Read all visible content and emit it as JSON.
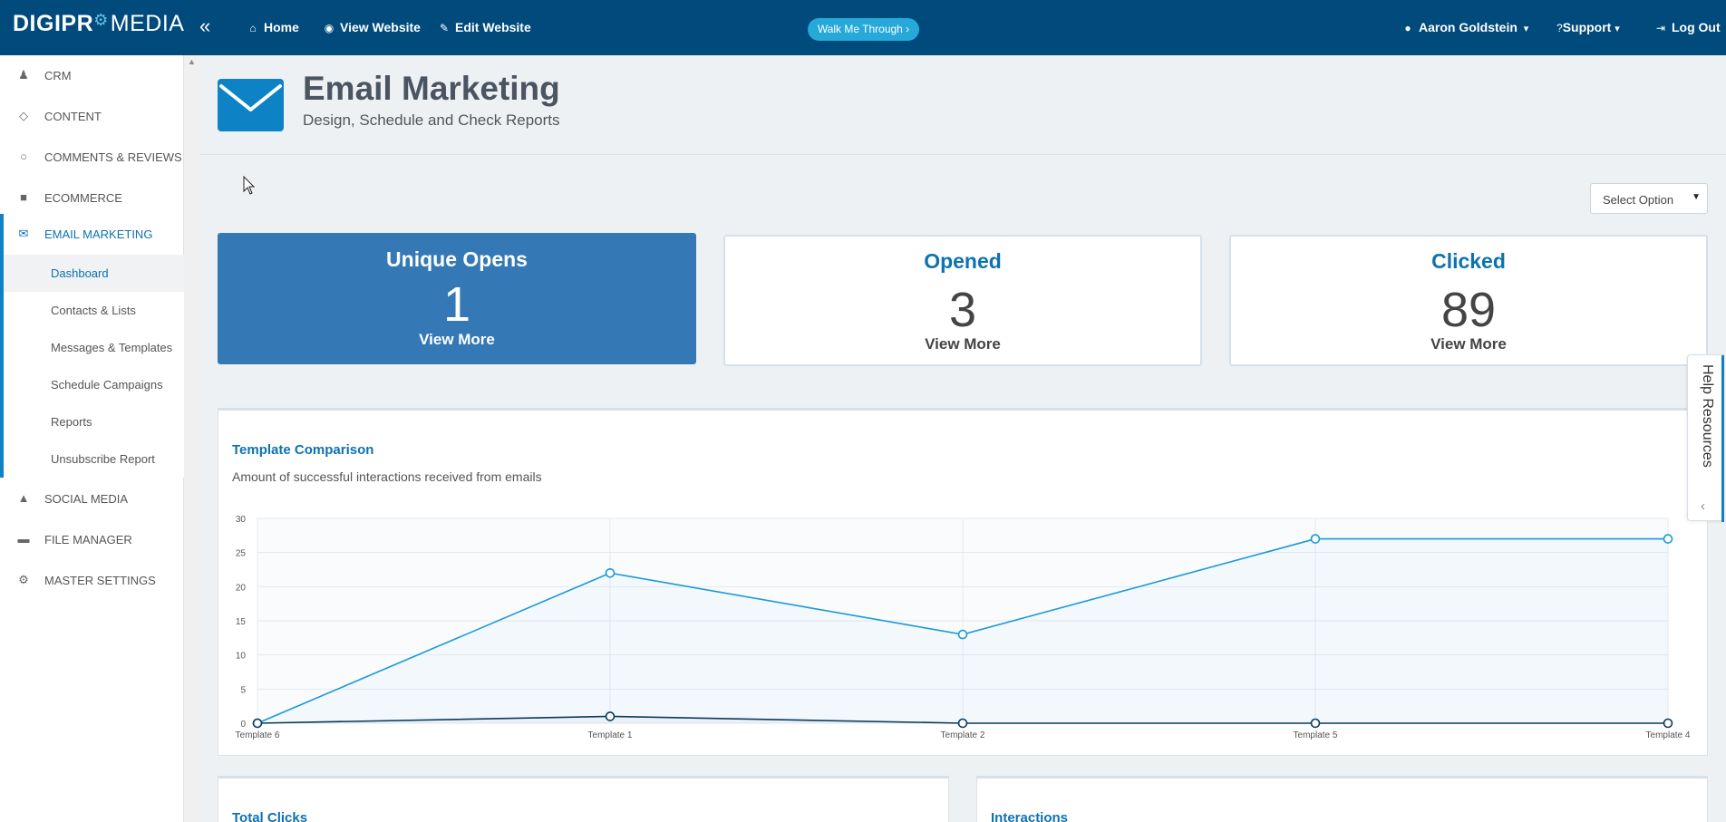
{
  "topbar": {
    "logo_part1": "DIGIPR",
    "logo_part2": "MEDIA",
    "links": [
      {
        "label": "Home"
      },
      {
        "label": "View Website"
      },
      {
        "label": "Edit Website"
      }
    ],
    "walk_label": "Walk Me Through ›",
    "user_label": "Aaron Goldstein",
    "support_label": "Support",
    "logout_label": "Log Out"
  },
  "sidebar": {
    "items": [
      {
        "label": "CRM"
      },
      {
        "label": "CONTENT"
      },
      {
        "label": "COMMENTS & REVIEWS"
      },
      {
        "label": "ECOMMERCE"
      },
      {
        "label": "EMAIL MARKETING"
      },
      {
        "label": "SOCIAL MEDIA"
      },
      {
        "label": "FILE MANAGER"
      },
      {
        "label": "MASTER SETTINGS"
      }
    ],
    "sub_items": [
      {
        "label": "Dashboard"
      },
      {
        "label": "Contacts & Lists"
      },
      {
        "label": "Messages & Templates"
      },
      {
        "label": "Schedule Campaigns"
      },
      {
        "label": "Reports"
      },
      {
        "label": "Unsubscribe Report"
      }
    ]
  },
  "header": {
    "title": "Email Marketing",
    "subtitle": "Design, Schedule and Check Reports"
  },
  "select": {
    "label": "Select Option"
  },
  "stats": [
    {
      "title": "Unique Opens",
      "value": "1",
      "more": "View More"
    },
    {
      "title": "Opened",
      "value": "3",
      "more": "View More"
    },
    {
      "title": "Clicked",
      "value": "89",
      "more": "View More"
    }
  ],
  "chart_panel": {
    "title": "Template Comparison",
    "subtitle": "Amount of successful interactions received from emails"
  },
  "chart_data": {
    "type": "line",
    "categories": [
      "Template 6",
      "Template 1",
      "Template 2",
      "Template 5",
      "Template 4"
    ],
    "series": [
      {
        "color": "#1a9ad6",
        "values": [
          0,
          22,
          13,
          27,
          27
        ]
      },
      {
        "color": "#0a3a5c",
        "values": [
          0,
          1,
          0,
          0,
          0
        ]
      }
    ],
    "ylim": [
      0,
      30
    ],
    "yticks": [
      0,
      5,
      10,
      15,
      20,
      25,
      30
    ],
    "grid": true,
    "area_fill": true
  },
  "bottom_panels": [
    {
      "title": "Total Clicks"
    },
    {
      "title": "Interactions"
    }
  ],
  "help_tab": {
    "label": "Help Resources"
  },
  "colors": {
    "topbar": "#004a7c",
    "accent": "#0d82c4",
    "card_primary": "#3479b5",
    "walk_button": "#26a9d8"
  }
}
